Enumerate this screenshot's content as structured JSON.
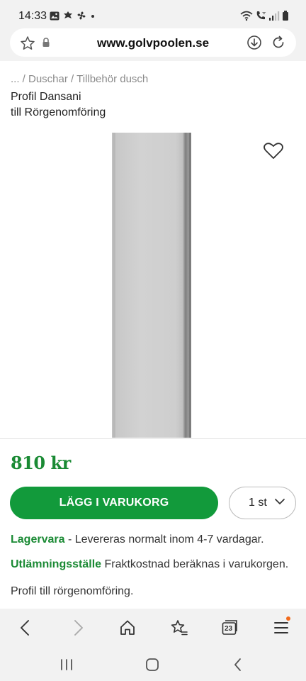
{
  "status_bar": {
    "time": "14:33",
    "left_icons": [
      "image-icon",
      "leaf-icon",
      "fan-icon",
      "dot-icon"
    ],
    "right_icons": [
      "wifi-icon",
      "call-icon",
      "signal-icon",
      "battery-icon"
    ]
  },
  "url_bar": {
    "url": "www.golvpoolen.se",
    "icons": [
      "star-icon",
      "lock-icon",
      "download-icon",
      "reload-icon"
    ]
  },
  "breadcrumb": "... / Duschar / Tillbehör dusch",
  "product": {
    "title_line1": "Profil Dansani",
    "title_line2": "till Rörgenomföring",
    "price": "810 kr",
    "add_to_cart_label": "LÄGG I VARUKORG",
    "quantity_selected": "1 st",
    "stock_status": "Lagervara",
    "stock_text": " - Levereras normalt inom 4-7 vardagar.",
    "pickup_label": "Utlämningsställe",
    "pickup_text": " Fraktkostnad beräknas i varukorgen.",
    "description": "Profil till rörgenomföring."
  },
  "browser_nav": {
    "icons": [
      "back-icon",
      "forward-icon",
      "home-icon",
      "bookmarks-icon",
      "tabs-icon",
      "menu-icon"
    ],
    "tab_count": "23"
  },
  "system_nav": {
    "icons": [
      "recents-icon",
      "home-circle-icon",
      "system-back-icon"
    ]
  },
  "colors": {
    "brand_green": "#129a3b",
    "text_green": "#1a8a34",
    "notification_dot": "#f26a1b"
  }
}
